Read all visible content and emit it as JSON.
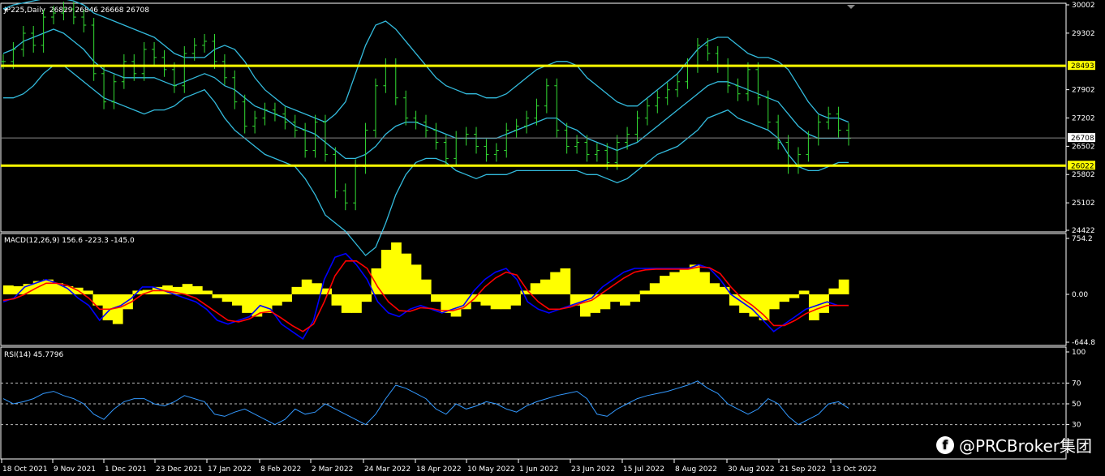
{
  "chart_data": [
    {
      "type": "line",
      "panel": "price",
      "title": "JP225,Daily",
      "ohlc": {
        "open": 26829,
        "high": 26846,
        "low": 26668,
        "close": 26708
      },
      "ohlc_text": "26829 26846 26668 26708",
      "ylim": [
        24422,
        30002
      ],
      "yticks": [
        30002,
        29302,
        27902,
        27202,
        26502,
        25802,
        25102,
        24422
      ],
      "levels": [
        {
          "value": 28493,
          "label": "28493",
          "color": "#ffff00"
        },
        {
          "value": 26022,
          "label": "26022",
          "color": "#ffff00"
        }
      ],
      "last_price": {
        "value": 26708,
        "label": "26708"
      },
      "series": [
        {
          "kind": "close",
          "color": "#33dd33",
          "values": [
            28600,
            28900,
            29300,
            29000,
            29700,
            29800,
            29900,
            29700,
            29500,
            28300,
            27600,
            28100,
            28600,
            28300,
            28900,
            28700,
            28400,
            28000,
            28800,
            29000,
            29100,
            28600,
            28200,
            27600,
            27000,
            27200,
            27400,
            27300,
            27100,
            26900,
            26400,
            27100,
            26300,
            25400,
            25100,
            26000,
            26900,
            28000,
            28500,
            27700,
            27200,
            27100,
            26900,
            26600,
            26200,
            26700,
            26800,
            26500,
            26300,
            26400,
            26900,
            27000,
            27200,
            27500,
            28000,
            26900,
            26500,
            26600,
            26300,
            26400,
            26100,
            26600,
            26800,
            27200,
            27500,
            27700,
            27900,
            28100,
            28500,
            29000,
            28800,
            28500,
            28000,
            27800,
            28400,
            27700,
            27100,
            26600,
            26000,
            26300,
            26700,
            27100,
            27300,
            26900,
            26700
          ]
        },
        {
          "kind": "bollinger-upper",
          "color": "#33bbdd",
          "values": [
            29900,
            30000,
            30050,
            30100,
            30150,
            30200,
            30150,
            30100,
            30000,
            29800,
            29700,
            29600,
            29500,
            29400,
            29300,
            29200,
            29000,
            28800,
            28700,
            28700,
            28700,
            28900,
            29000,
            28900,
            28600,
            28200,
            27900,
            27700,
            27500,
            27400,
            27300,
            27200,
            27100,
            27300,
            27600,
            28300,
            29000,
            29500,
            29600,
            29400,
            29100,
            28800,
            28500,
            28200,
            28000,
            27900,
            27800,
            27800,
            27700,
            27700,
            27800,
            28000,
            28200,
            28400,
            28500,
            28600,
            28600,
            28500,
            28200,
            28000,
            27800,
            27600,
            27500,
            27500,
            27700,
            27900,
            28100,
            28300,
            28600,
            28900,
            29100,
            29200,
            29200,
            29000,
            28800,
            28700,
            28700,
            28600,
            28400,
            28000,
            27600,
            27300,
            27200,
            27200,
            27100
          ]
        },
        {
          "kind": "bollinger-middle",
          "color": "#33bbdd",
          "values": [
            28800,
            28900,
            29100,
            29200,
            29300,
            29400,
            29300,
            29100,
            28900,
            28600,
            28400,
            28300,
            28200,
            28200,
            28200,
            28200,
            28100,
            28000,
            28100,
            28200,
            28300,
            28200,
            28000,
            27900,
            27700,
            27500,
            27400,
            27300,
            27200,
            27000,
            26900,
            26800,
            26600,
            26400,
            26200,
            26200,
            26300,
            26500,
            26800,
            27000,
            27100,
            27100,
            27000,
            26900,
            26800,
            26700,
            26700,
            26700,
            26700,
            26700,
            26800,
            26900,
            27000,
            27100,
            27200,
            27200,
            27000,
            26900,
            26700,
            26600,
            26500,
            26400,
            26500,
            26600,
            26800,
            27000,
            27200,
            27400,
            27600,
            27800,
            28000,
            28100,
            28100,
            28000,
            27900,
            27800,
            27700,
            27600,
            27300,
            27000,
            26800,
            26700,
            26700,
            26700,
            26700
          ]
        },
        {
          "kind": "bollinger-lower",
          "color": "#33bbdd",
          "values": [
            27700,
            27700,
            27800,
            28000,
            28300,
            28500,
            28500,
            28300,
            28100,
            27900,
            27700,
            27600,
            27500,
            27400,
            27300,
            27400,
            27400,
            27500,
            27700,
            27800,
            27900,
            27600,
            27200,
            26900,
            26700,
            26500,
            26300,
            26200,
            26100,
            26000,
            25700,
            25300,
            24800,
            24600,
            24400,
            24100,
            23800,
            24000,
            24600,
            25300,
            25800,
            26100,
            26200,
            26200,
            26100,
            25900,
            25800,
            25700,
            25800,
            25800,
            25800,
            25900,
            25900,
            25900,
            25900,
            25900,
            25900,
            25900,
            25800,
            25800,
            25700,
            25600,
            25700,
            25900,
            26100,
            26300,
            26400,
            26500,
            26700,
            26900,
            27200,
            27300,
            27400,
            27200,
            27100,
            27000,
            26900,
            26700,
            26300,
            26000,
            25900,
            25900,
            26000,
            26100,
            26100
          ]
        }
      ]
    },
    {
      "type": "bar",
      "panel": "macd",
      "title": "MACD(12,26,9) 156.6 -223.3 -145.0",
      "ylim": [
        -644.8,
        754.2
      ],
      "yticks": [
        754.2,
        0.0,
        -644.8
      ],
      "ytick_labels": [
        "754.2",
        "0.00",
        "-644.8"
      ],
      "histogram_color": "#ffff00",
      "histogram": [
        120,
        110,
        140,
        180,
        200,
        150,
        110,
        90,
        50,
        -150,
        -350,
        -400,
        -200,
        50,
        60,
        100,
        120,
        100,
        140,
        110,
        50,
        -50,
        -100,
        -150,
        -250,
        -300,
        -250,
        -150,
        -100,
        100,
        200,
        150,
        80,
        -150,
        -250,
        -250,
        -100,
        350,
        600,
        700,
        550,
        400,
        200,
        -100,
        -250,
        -300,
        -200,
        -100,
        -150,
        -200,
        -200,
        -150,
        50,
        150,
        200,
        300,
        350,
        -150,
        -300,
        -250,
        -200,
        -100,
        -150,
        -100,
        50,
        150,
        250,
        300,
        350,
        400,
        300,
        150,
        100,
        -150,
        -250,
        -300,
        -350,
        -200,
        -100,
        -50,
        50,
        -350,
        -250,
        80,
        200
      ],
      "series": [
        {
          "name": "main",
          "color": "#0000ff",
          "values": [
            -100,
            -50,
            100,
            150,
            200,
            150,
            80,
            -50,
            -150,
            -350,
            -200,
            -150,
            -50,
            100,
            100,
            50,
            0,
            -50,
            -100,
            -200,
            -350,
            -400,
            -350,
            -300,
            -150,
            -200,
            -400,
            -500,
            -600,
            -350,
            200,
            500,
            550,
            400,
            200,
            -100,
            -250,
            -300,
            -200,
            -150,
            -200,
            -250,
            -200,
            -150,
            50,
            200,
            300,
            350,
            200,
            -100,
            -200,
            -250,
            -200,
            -150,
            -100,
            -50,
            100,
            200,
            300,
            350,
            350,
            350,
            350,
            350,
            350,
            400,
            350,
            200,
            0,
            -100,
            -200,
            -350,
            -500,
            -400,
            -300,
            -200,
            -150,
            -100,
            -150,
            -150
          ]
        },
        {
          "name": "signal",
          "color": "#ff0000",
          "values": [
            -80,
            -60,
            0,
            80,
            150,
            150,
            120,
            50,
            -50,
            -200,
            -200,
            -170,
            -100,
            0,
            50,
            50,
            30,
            0,
            -50,
            -150,
            -250,
            -350,
            -370,
            -330,
            -250,
            -230,
            -320,
            -420,
            -500,
            -400,
            -100,
            250,
            450,
            450,
            350,
            100,
            -100,
            -220,
            -230,
            -180,
            -190,
            -220,
            -220,
            -180,
            -60,
            100,
            220,
            300,
            260,
            50,
            -100,
            -200,
            -200,
            -170,
            -120,
            -80,
            20,
            120,
            220,
            300,
            330,
            340,
            340,
            340,
            340,
            370,
            360,
            280,
            100,
            -50,
            -150,
            -270,
            -420,
            -420,
            -350,
            -260,
            -200,
            -150,
            -150,
            -150
          ]
        }
      ]
    },
    {
      "type": "line",
      "panel": "rsi",
      "title": "RSI(14) 45.7796",
      "ylim": [
        0,
        100
      ],
      "yticks": [
        100,
        70,
        50,
        30
      ],
      "levels": [
        70,
        50,
        30
      ],
      "series": [
        {
          "name": "RSI(14)",
          "color": "#3399ff",
          "values": [
            55,
            50,
            52,
            55,
            60,
            62,
            58,
            55,
            50,
            40,
            35,
            45,
            52,
            55,
            55,
            50,
            48,
            52,
            58,
            55,
            52,
            40,
            38,
            42,
            45,
            40,
            35,
            30,
            35,
            45,
            40,
            42,
            50,
            45,
            40,
            35,
            30,
            40,
            55,
            68,
            65,
            60,
            55,
            45,
            40,
            50,
            45,
            48,
            52,
            50,
            45,
            42,
            48,
            52,
            55,
            58,
            60,
            62,
            55,
            40,
            38,
            45,
            50,
            55,
            58,
            60,
            62,
            65,
            68,
            72,
            65,
            60,
            50,
            45,
            40,
            45,
            55,
            50,
            38,
            30,
            35,
            40,
            50,
            52,
            45.8
          ]
        }
      ]
    }
  ],
  "x_axis": {
    "tick_labels": [
      "18 Oct 2021",
      "9 Nov 2021",
      "1 Dec 2021",
      "23 Dec 2021",
      "17 Jan 2022",
      "8 Feb 2022",
      "2 Mar 2022",
      "24 Mar 2022",
      "18 Apr 2022",
      "10 May 2022",
      "1 Jun 2022",
      "23 Jun 2022",
      "15 Jul 2022",
      "8 Aug 2022",
      "30 Aug 2022",
      "21 Sep 2022",
      "13 Oct 2022"
    ]
  },
  "watermark": {
    "icon": "facebook-icon",
    "text": "@PRCBroker集团"
  }
}
